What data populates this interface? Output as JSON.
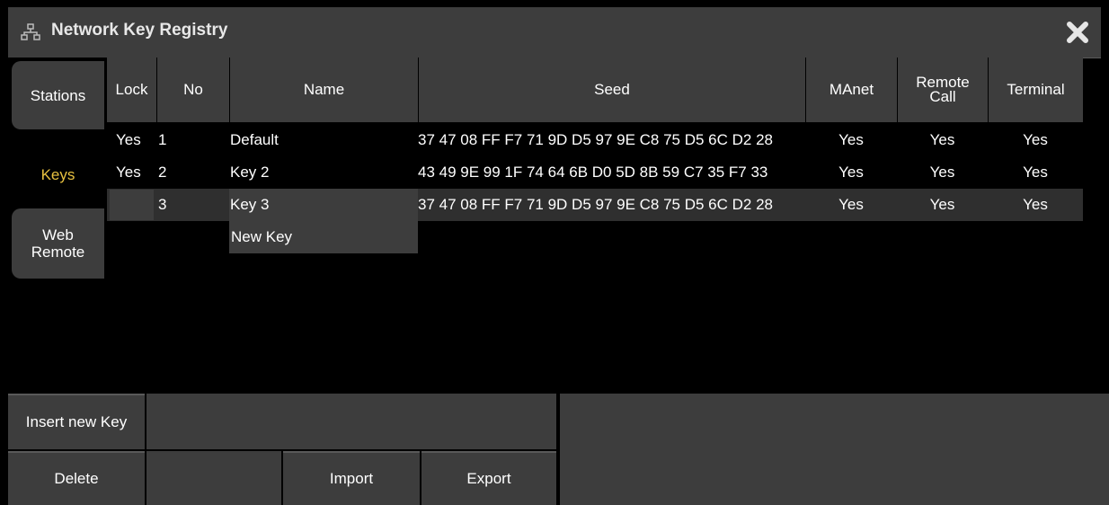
{
  "window": {
    "title": "Network Key Registry",
    "title_icon": "network-icon",
    "close_icon": "close-x-icon"
  },
  "tabs": [
    {
      "label": "Stations",
      "active": false
    },
    {
      "label": "Keys",
      "active": true
    },
    {
      "label": "Web Remote",
      "active": false
    }
  ],
  "table": {
    "columns": [
      "Lock",
      "No",
      "Name",
      "Seed",
      "MAnet",
      "Remote Call",
      "Terminal"
    ],
    "rows": [
      {
        "lock": "Yes",
        "no": "1",
        "name": "Default",
        "seed": "37 47 08 FF F7 71 9D D5 97 9E C8 75 D5 6C D2 28",
        "manet": "Yes",
        "remote_call": "Yes",
        "terminal": "Yes"
      },
      {
        "lock": "Yes",
        "no": "2",
        "name": "Key 2",
        "seed": "43 49 9E 99 1F 74 64 6B D0 5D 8B 59 C7 35 F7 33",
        "manet": "Yes",
        "remote_call": "Yes",
        "terminal": "Yes"
      },
      {
        "lock": "",
        "no": "3",
        "name": "Key 3",
        "seed": "37 47 08 FF F7 71 9D D5 97 9E C8 75 D5 6C D2 28",
        "manet": "Yes",
        "remote_call": "Yes",
        "terminal": "Yes"
      }
    ],
    "new_key_label": "New Key"
  },
  "buttons": {
    "insert_new_key": "Insert new Key",
    "delete": "Delete",
    "import": "Import",
    "export": "Export"
  },
  "colors": {
    "background": "#000000",
    "panel": "#3d3d3d",
    "active_tab_text": "#e8c140"
  }
}
